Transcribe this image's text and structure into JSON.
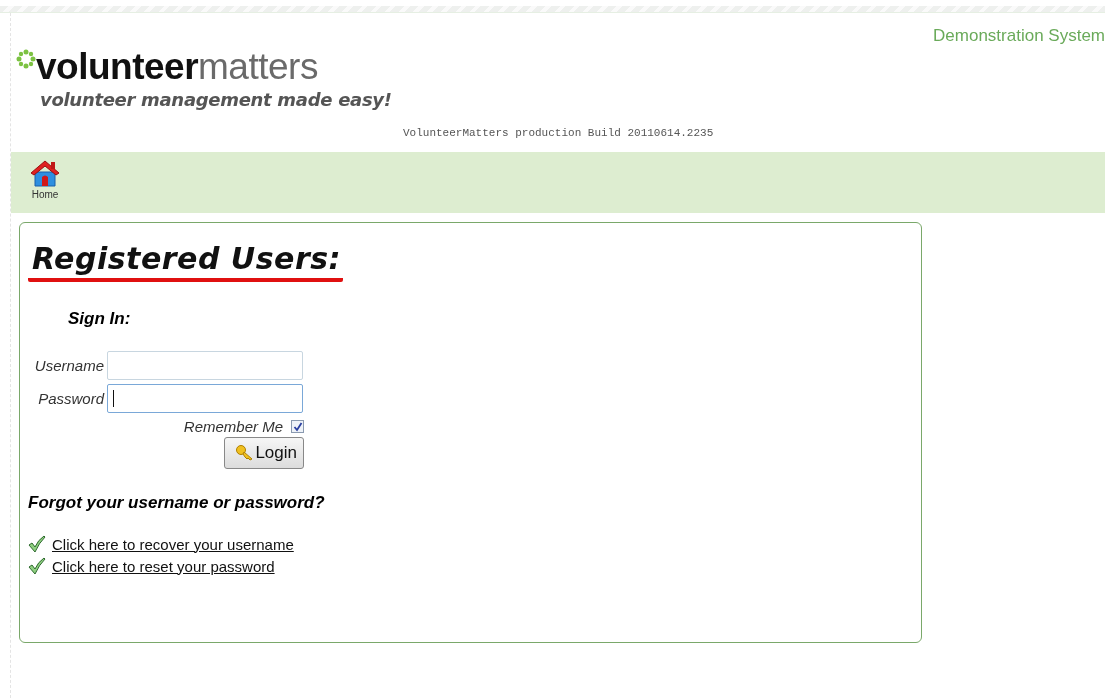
{
  "header": {
    "logo_bold": "volunteer",
    "logo_light": "matters",
    "tagline": "volunteer management made easy!",
    "build": "VolunteerMatters production Build 20110614.2235",
    "system": "Demonstration System"
  },
  "nav": [
    {
      "label": "Home"
    }
  ],
  "panel": {
    "title": "Registered Users:",
    "subtitle": "Sign In:",
    "fields": [
      {
        "label": "Username",
        "focused": false
      },
      {
        "label": "Password",
        "focused": true
      }
    ],
    "remember": {
      "label": "Remember Me",
      "checked": true
    },
    "button": "Login",
    "forgot_title": "Forgot your username or password?",
    "links": [
      {
        "text": "Click here to recover your username"
      },
      {
        "text": "Click here to reset your password"
      }
    ]
  }
}
